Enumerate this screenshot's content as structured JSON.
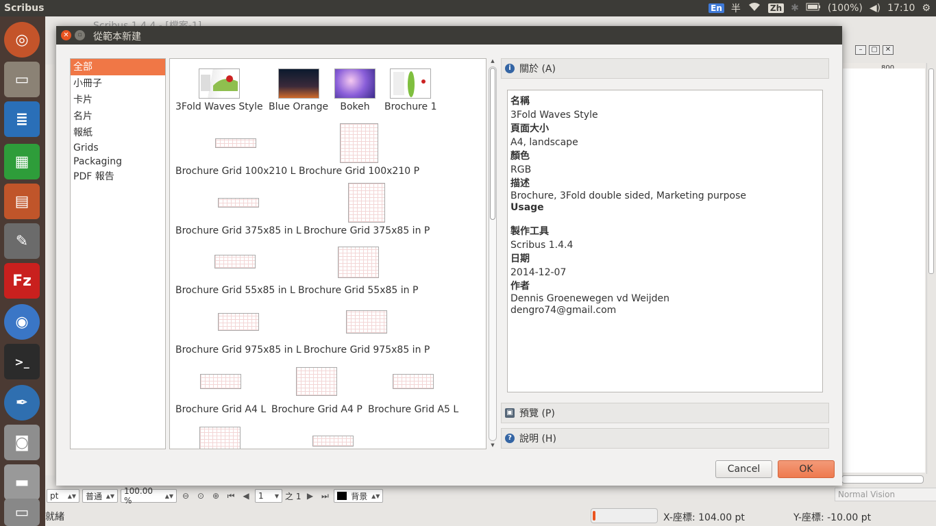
{
  "top_panel": {
    "app_name": "Scribus",
    "tray": {
      "input_method": "En",
      "half_width": "半",
      "keyboard": "Zh",
      "battery": "(100%)",
      "time": "17:10"
    }
  },
  "launcher": {
    "items": [
      "ubuntu-dash",
      "files",
      "libreoffice-writer",
      "libreoffice-calc",
      "libreoffice-impress",
      "system-settings",
      "filezilla",
      "chromium",
      "terminal",
      "scribus",
      "camera",
      "drive",
      "trash"
    ]
  },
  "background_window": {
    "title": "Scribus 1.4.4 - [檔案-1]",
    "ruler_label": "800",
    "unit": "pt",
    "preview_mode": "普通",
    "zoom": "100.00 %",
    "page_number": "1",
    "page_of": "之 1",
    "layer": "背景",
    "vision": "Normal Vision",
    "status": "就緒",
    "progress": 0.04,
    "x_coord": "X-座標: 104.00 pt",
    "y_coord": "Y-座標: -10.00 pt"
  },
  "dialog": {
    "title": "從範本新建",
    "categories": [
      {
        "label": "全部",
        "selected": true
      },
      {
        "label": "小冊子"
      },
      {
        "label": "卡片"
      },
      {
        "label": "名片"
      },
      {
        "label": "報紙"
      },
      {
        "label": "Grids"
      },
      {
        "label": "Packaging"
      },
      {
        "label": "PDF 報告"
      }
    ],
    "templates": [
      "3Fold Waves Style",
      "Blue Orange",
      "Bokeh",
      "Brochure 1",
      "Brochure Grid 100x210 L",
      "Brochure Grid 100x210 P",
      "Brochure Grid 375x85 in L",
      "Brochure Grid 375x85 in P",
      "Brochure Grid 55x85 in L",
      "Brochure Grid 55x85 in P",
      "Brochure Grid 975x85 in L",
      "Brochure Grid 975x85 in P",
      "Brochure Grid A4 L",
      "Brochure Grid A4 P",
      "Brochure Grid A5 L"
    ],
    "about": {
      "header": "關於 (A)",
      "name_label": "名稱",
      "name": "3Fold Waves Style",
      "size_label": "頁面大小",
      "size": "A4, landscape",
      "color_label": "顏色",
      "color": "RGB",
      "desc_label": "描述",
      "desc": "Brochure, 3Fold double sided, Marketing purpose",
      "usage_label": "Usage",
      "tool_label": "製作工具",
      "tool": "Scribus 1.4.4",
      "date_label": "日期",
      "date": "2014-12-07",
      "author_label": "作者",
      "author": "Dennis Groenewegen vd Weijden",
      "email": "dengro74@gmail.com"
    },
    "preview_header": "預覽 (P)",
    "help_header": "說明 (H)",
    "cancel_label": "Cancel",
    "ok_label": "OK"
  },
  "colors": {
    "accent": "#f07746",
    "panel": "#3c3b37",
    "dialog_bg": "#f2f1f0"
  }
}
